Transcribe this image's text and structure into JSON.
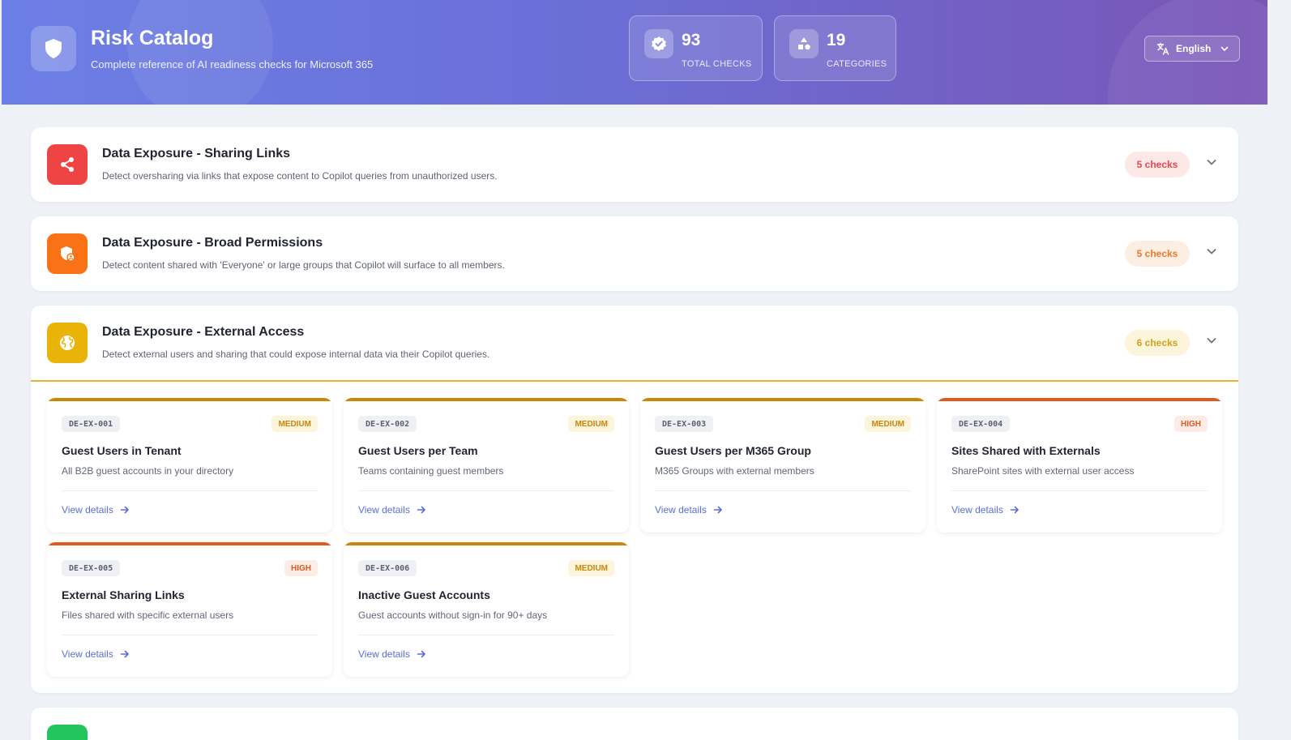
{
  "header": {
    "title": "Risk Catalog",
    "subtitle": "Complete reference of AI readiness checks for Microsoft 365",
    "stats": [
      {
        "value": "93",
        "label": "TOTAL CHECKS",
        "icon": "badge-check-icon"
      },
      {
        "value": "19",
        "label": "CATEGORIES",
        "icon": "shapes-icon"
      }
    ],
    "language": "English"
  },
  "colors": {
    "header_start": "#6c7fe6",
    "header_end": "#7a55b6",
    "red": "#ef4444",
    "orange": "#f97316",
    "yellow": "#eab308",
    "green": "#22c55e",
    "medium": "#c8860a",
    "high": "#e0591f",
    "link": "#5a6fd6"
  },
  "categories": [
    {
      "title": "Data Exposure - Sharing Links",
      "description": "Detect oversharing via links that expose content to Copilot queries from unauthorized users.",
      "count": "5 checks",
      "icon": "share-icon",
      "color": "#ef4444",
      "expanded": false
    },
    {
      "title": "Data Exposure - Broad Permissions",
      "description": "Detect content shared with 'Everyone' or large groups that Copilot will surface to all members.",
      "count": "5 checks",
      "icon": "shield-user-icon",
      "color": "#f97316",
      "expanded": false
    },
    {
      "title": "Data Exposure - External Access",
      "description": "Detect external users and sharing that could expose internal data via their Copilot queries.",
      "count": "6 checks",
      "icon": "globe-icon",
      "color": "#eab308",
      "expanded": true,
      "checks": [
        {
          "id": "DE-EX-001",
          "severity": "MEDIUM",
          "title": "Guest Users in Tenant",
          "description": "All B2B guest accounts in your directory",
          "link": "View details"
        },
        {
          "id": "DE-EX-002",
          "severity": "MEDIUM",
          "title": "Guest Users per Team",
          "description": "Teams containing guest members",
          "link": "View details"
        },
        {
          "id": "DE-EX-003",
          "severity": "MEDIUM",
          "title": "Guest Users per M365 Group",
          "description": "M365 Groups with external members",
          "link": "View details"
        },
        {
          "id": "DE-EX-004",
          "severity": "HIGH",
          "title": "Sites Shared with Externals",
          "description": "SharePoint sites with external user access",
          "link": "View details"
        },
        {
          "id": "DE-EX-005",
          "severity": "HIGH",
          "title": "External Sharing Links",
          "description": "Files shared with specific external users",
          "link": "View details"
        },
        {
          "id": "DE-EX-006",
          "severity": "MEDIUM",
          "title": "Inactive Guest Accounts",
          "description": "Guest accounts without sign-in for 90+ days",
          "link": "View details"
        }
      ]
    }
  ]
}
